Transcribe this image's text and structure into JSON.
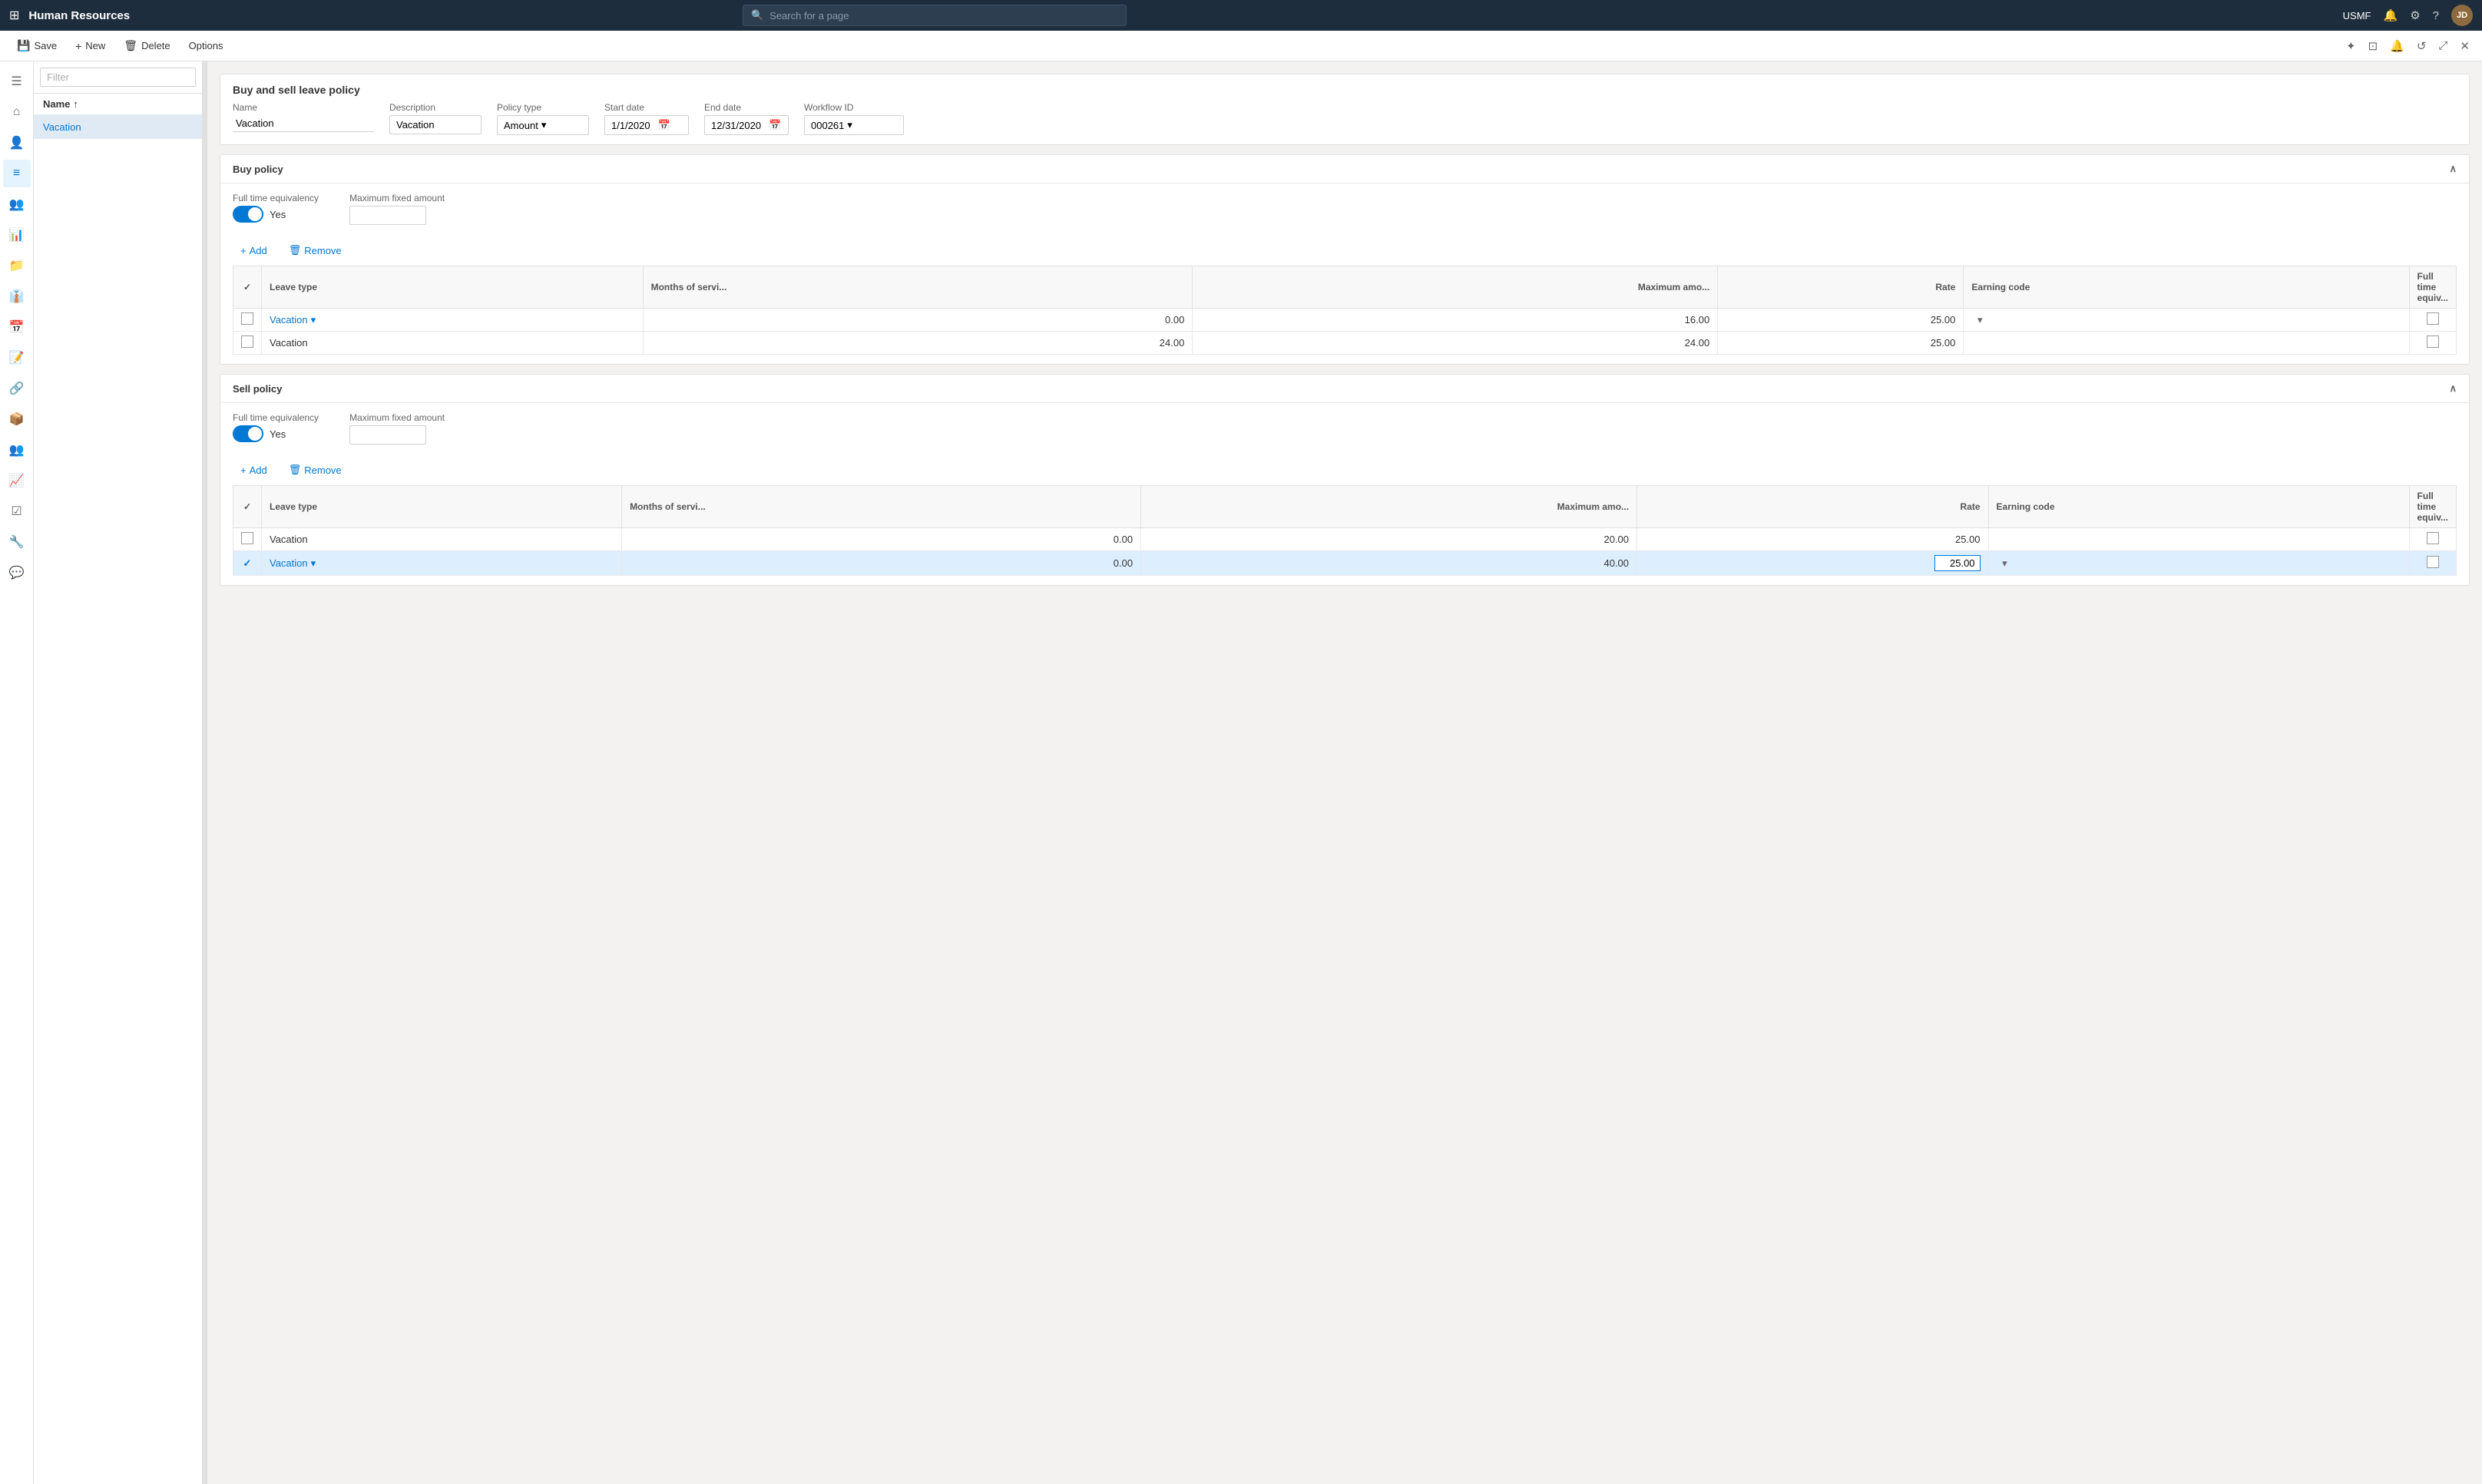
{
  "app": {
    "title": "Human Resources",
    "search_placeholder": "Search for a page",
    "username": "USMF"
  },
  "action_bar": {
    "save_label": "Save",
    "new_label": "New",
    "delete_label": "Delete",
    "options_label": "Options"
  },
  "sidebar": {
    "icons": [
      "☰",
      "⌂",
      "👤",
      "📋",
      "👥",
      "📊",
      "📁",
      "👔",
      "📅",
      "📝",
      "🔗",
      "📦",
      "👥",
      "📈",
      "📋",
      "🔧",
      "💬"
    ]
  },
  "filter": {
    "placeholder": "Filter"
  },
  "records": {
    "header_col": "Name",
    "sort": "↑",
    "items": [
      {
        "label": "Vacation",
        "selected": true
      }
    ]
  },
  "form": {
    "title": "Buy and sell leave policy",
    "fields": {
      "name_label": "Name",
      "name_value": "Vacation",
      "description_label": "Description",
      "description_value": "Vacation",
      "policy_type_label": "Policy type",
      "policy_type_value": "Amount",
      "start_date_label": "Start date",
      "start_date_value": "1/1/2020",
      "end_date_label": "End date",
      "end_date_value": "12/31/2020",
      "workflow_id_label": "Workflow ID",
      "workflow_id_value": "000261"
    }
  },
  "buy_policy": {
    "title": "Buy policy",
    "fte_label": "Full time equivalency",
    "fte_value": "Yes",
    "max_amount_label": "Maximum fixed amount",
    "max_amount_value": "",
    "add_label": "Add",
    "remove_label": "Remove",
    "table": {
      "col_check": "",
      "col_leave_type": "Leave type",
      "col_months": "Months of servi...",
      "col_max_amount": "Maximum amo...",
      "col_rate": "Rate",
      "col_earning_code": "Earning code",
      "col_fte": "Full time equiv...",
      "rows": [
        {
          "selected": false,
          "leave_type": "Vacation",
          "months": "0.00",
          "max_amount": "16.00",
          "rate": "25.00",
          "earning_code": "",
          "fte": false,
          "is_link": true
        },
        {
          "selected": false,
          "leave_type": "Vacation",
          "months": "24.00",
          "max_amount": "24.00",
          "rate": "25.00",
          "earning_code": "",
          "fte": false,
          "is_link": false
        }
      ]
    }
  },
  "sell_policy": {
    "title": "Sell policy",
    "fte_label": "Full time equivalency",
    "fte_value": "Yes",
    "max_amount_label": "Maximum fixed amount",
    "max_amount_value": "",
    "add_label": "Add",
    "remove_label": "Remove",
    "table": {
      "col_check": "",
      "col_leave_type": "Leave type",
      "col_months": "Months of servi...",
      "col_max_amount": "Maximum amo...",
      "col_rate": "Rate",
      "col_earning_code": "Earning code",
      "col_fte": "Full time equiv...",
      "rows": [
        {
          "selected": false,
          "leave_type": "Vacation",
          "months": "0.00",
          "max_amount": "20.00",
          "rate": "25.00",
          "earning_code": "",
          "fte": false,
          "is_link": false
        },
        {
          "selected": true,
          "leave_type": "Vacation",
          "months": "0.00",
          "max_amount": "40.00",
          "rate": "25.00",
          "editing_rate": true,
          "earning_code": "",
          "fte": false,
          "is_link": true
        }
      ]
    }
  }
}
